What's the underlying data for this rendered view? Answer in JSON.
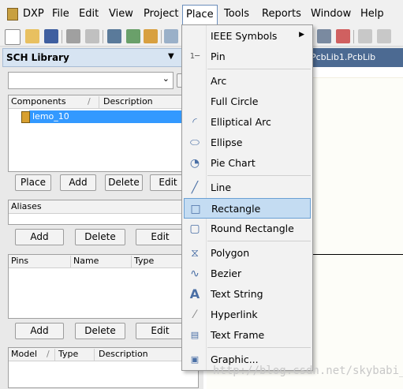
{
  "menubar": {
    "logo": "DXP",
    "items": [
      "File",
      "Edit",
      "View",
      "Project",
      "Place",
      "Tools",
      "Reports",
      "Window",
      "Help"
    ],
    "active": "Place"
  },
  "panel": {
    "title": "SCH Library",
    "search_value": "",
    "components": {
      "headers": [
        "Components",
        "Description"
      ],
      "rows": [
        {
          "name": "lemo_10",
          "selected": true
        }
      ]
    },
    "component_buttons": [
      "Place",
      "Add",
      "Delete",
      "Edit"
    ],
    "aliases": {
      "header": "Aliases"
    },
    "alias_buttons": [
      "Add",
      "Delete",
      "Edit"
    ],
    "pins": {
      "headers": [
        "Pins",
        "Name",
        "Type"
      ]
    },
    "pin_buttons": [
      "Add",
      "Delete",
      "Edit"
    ],
    "model": {
      "headers": [
        "Model",
        "Type",
        "Description"
      ]
    }
  },
  "document": {
    "tab_label": "PcbLib1.PcbLib"
  },
  "place_menu": {
    "items": [
      {
        "label": "IEEE Symbols",
        "icon": "ieee-icon",
        "submenu": true
      },
      {
        "label": "Pin",
        "icon": "pin-icon"
      },
      {
        "label": "Arc",
        "icon": "arc-icon"
      },
      {
        "label": "Full Circle",
        "icon": "full-circle-icon"
      },
      {
        "label": "Elliptical Arc",
        "icon": "elliptical-arc-icon"
      },
      {
        "label": "Ellipse",
        "icon": "ellipse-icon"
      },
      {
        "label": "Pie Chart",
        "icon": "pie-chart-icon"
      },
      {
        "label": "Line",
        "icon": "line-icon"
      },
      {
        "label": "Rectangle",
        "icon": "rectangle-icon",
        "highlighted": true
      },
      {
        "label": "Round Rectangle",
        "icon": "round-rectangle-icon"
      },
      {
        "label": "Polygon",
        "icon": "polygon-icon"
      },
      {
        "label": "Bezier",
        "icon": "bezier-icon"
      },
      {
        "label": "Text String",
        "icon": "text-string-icon"
      },
      {
        "label": "Hyperlink",
        "icon": "hyperlink-icon"
      },
      {
        "label": "Text Frame",
        "icon": "text-frame-icon"
      },
      {
        "label": "Graphic...",
        "icon": "graphic-icon"
      }
    ]
  },
  "watermark": "http://blog.csdn.net/skybabi_"
}
